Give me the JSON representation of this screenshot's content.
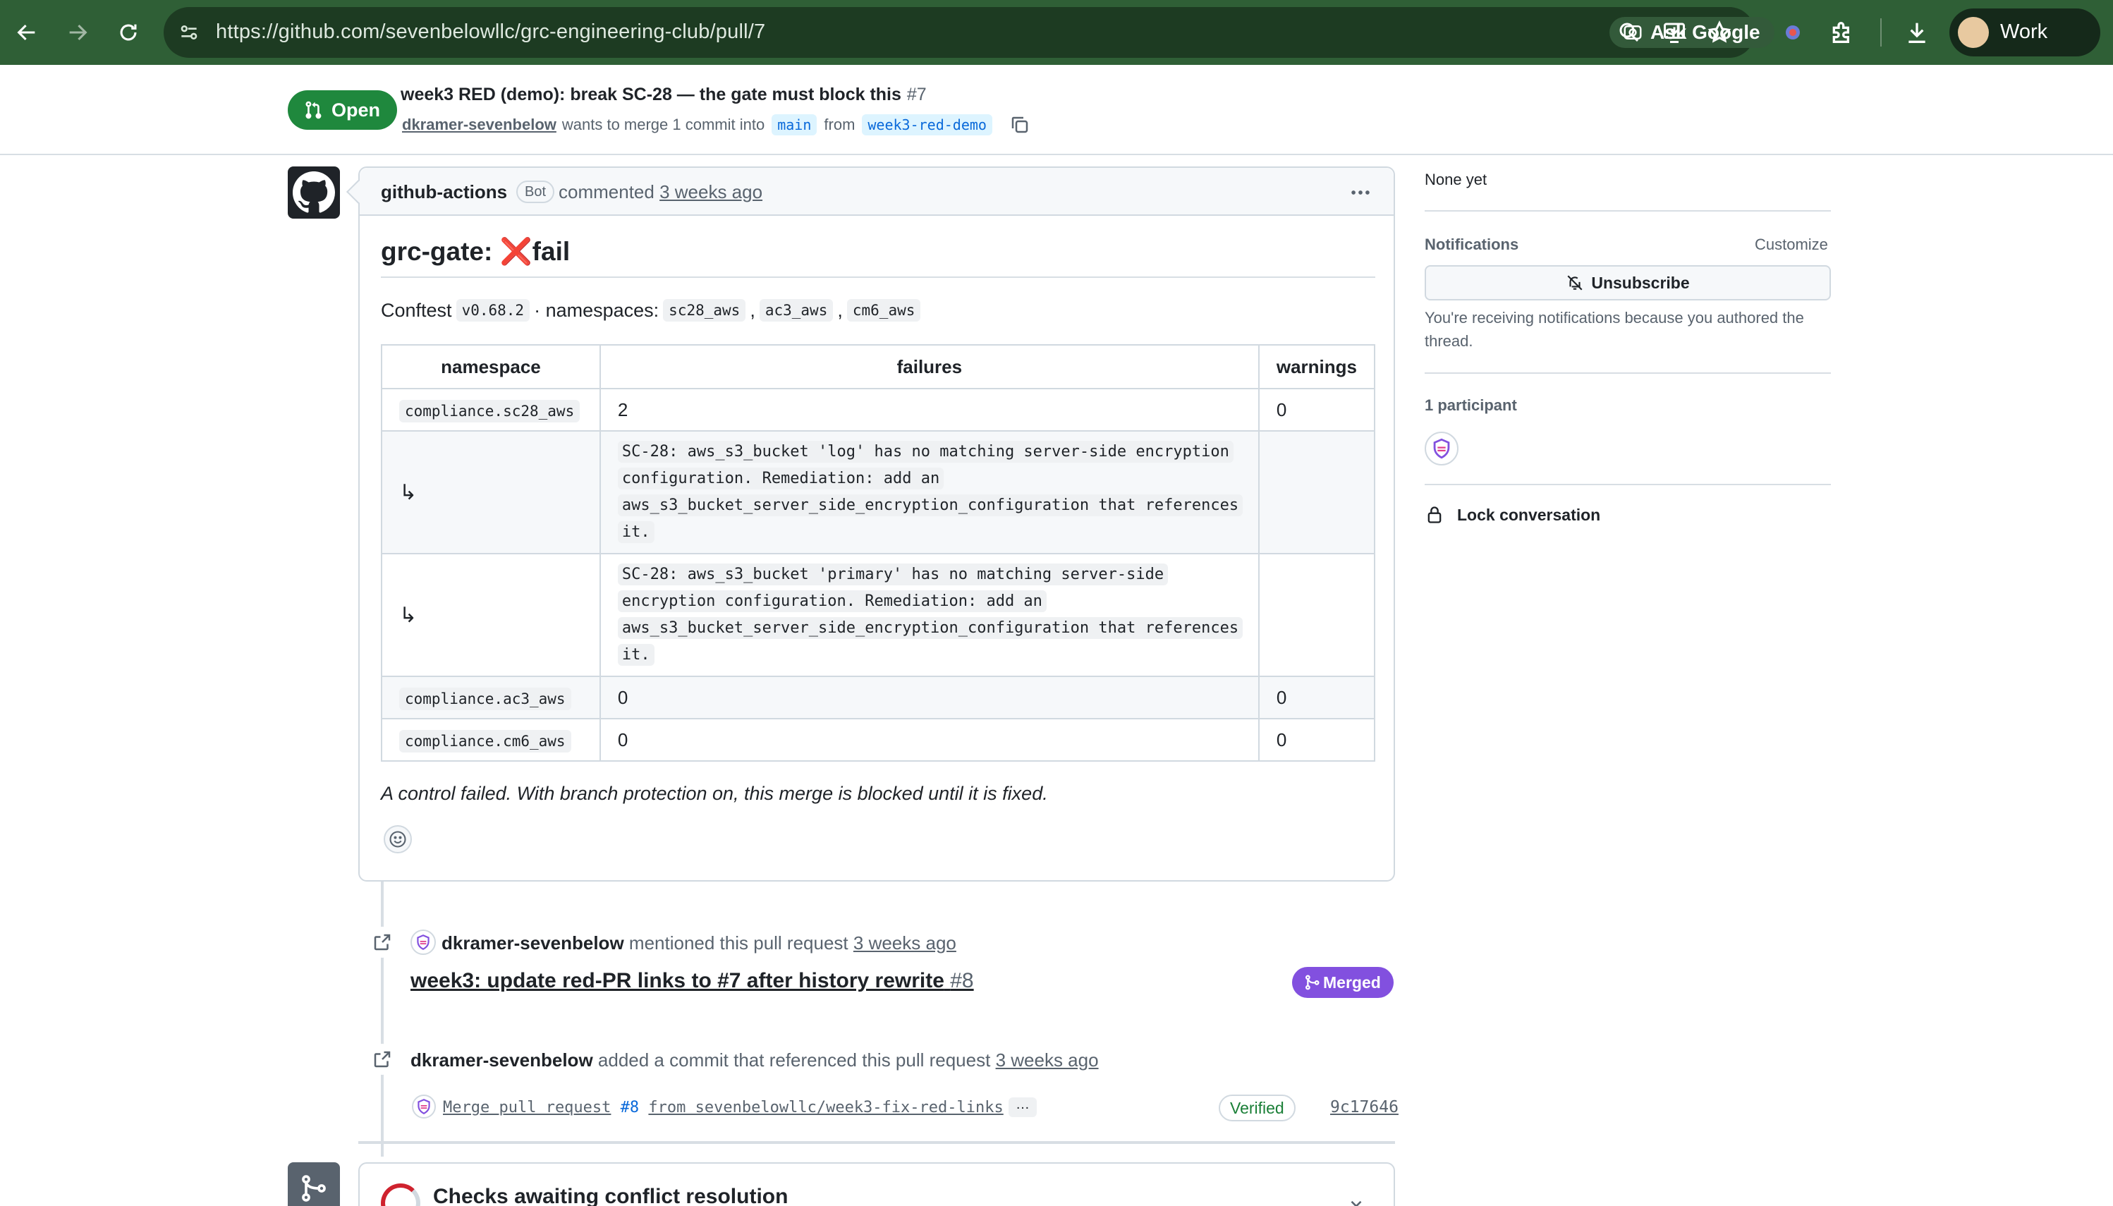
{
  "browser": {
    "url": "https://github.com/sevenbelowllc/grc-engineering-club/pull/7",
    "ask_google": "Ask Google",
    "profile_name": "Work"
  },
  "pr": {
    "state": "Open",
    "title": "week3 RED (demo): break SC-28 — the gate must block this",
    "number": "#7",
    "author": "dkramer-sevenbelow",
    "merge_text": "wants to merge 1 commit into",
    "base_branch": "main",
    "from_text": "from",
    "head_branch": "week3-red-demo"
  },
  "comment": {
    "author": "github-actions",
    "bot_label": "Bot",
    "action": "commented",
    "time": "3 weeks ago",
    "heading_prefix": "grc-gate:",
    "heading_emoji": "❌",
    "heading_suffix": "fail",
    "conftest_label": "Conftest",
    "conftest_version": "v0.68.2",
    "namespaces_label": "· namespaces:",
    "namespaces": [
      "sc28_aws",
      "ac3_aws",
      "cm6_aws"
    ],
    "table": {
      "headers": [
        "namespace",
        "failures",
        "warnings"
      ],
      "rows": [
        {
          "namespace": "compliance.sc28_aws",
          "failures": "2",
          "warnings": "0"
        },
        {
          "namespace": "↳",
          "failures": "SC-28: aws_s3_bucket 'log' has no matching server-side encryption configuration. Remediation: add an aws_s3_bucket_server_side_encryption_configuration that references it.",
          "warnings": ""
        },
        {
          "namespace": "↳",
          "failures": "SC-28: aws_s3_bucket 'primary' has no matching server-side encryption configuration. Remediation: add an aws_s3_bucket_server_side_encryption_configuration that references it.",
          "warnings": ""
        },
        {
          "namespace": "compliance.ac3_aws",
          "failures": "0",
          "warnings": "0"
        },
        {
          "namespace": "compliance.cm6_aws",
          "failures": "0",
          "warnings": "0"
        }
      ]
    },
    "footer": "A control failed. With branch protection on, this merge is blocked until it is fixed."
  },
  "events": {
    "mention": {
      "actor": "dkramer-sevenbelow",
      "text": "mentioned this pull request",
      "time": "3 weeks ago",
      "ref_title": "week3: update red-PR links to #7 after history rewrite",
      "ref_number": "#8",
      "ref_state": "Merged"
    },
    "commit": {
      "actor": "dkramer-sevenbelow",
      "text": "added a commit that referenced this pull request",
      "time": "3 weeks ago",
      "message_prefix": "Merge pull request",
      "message_pr": "#8",
      "message_suffix": "from sevenbelowllc/week3-fix-red-links",
      "ellipsis": "…",
      "verified": "Verified",
      "sha": "9c17646"
    }
  },
  "checks": {
    "title": "Checks awaiting conflict resolution"
  },
  "sidebar": {
    "milestone_value": "None yet",
    "notifications_heading": "Notifications",
    "customize": "Customize",
    "unsubscribe": "Unsubscribe",
    "notification_note": "You're receiving notifications because you authored the thread.",
    "participants_heading": "1 participant",
    "lock": "Lock conversation"
  },
  "colors": {
    "browser_bar": "#2f5f36",
    "open_badge": "#1f883d",
    "merged_badge": "#8250df",
    "verified": "#1a7f37",
    "link": "#0969da"
  }
}
